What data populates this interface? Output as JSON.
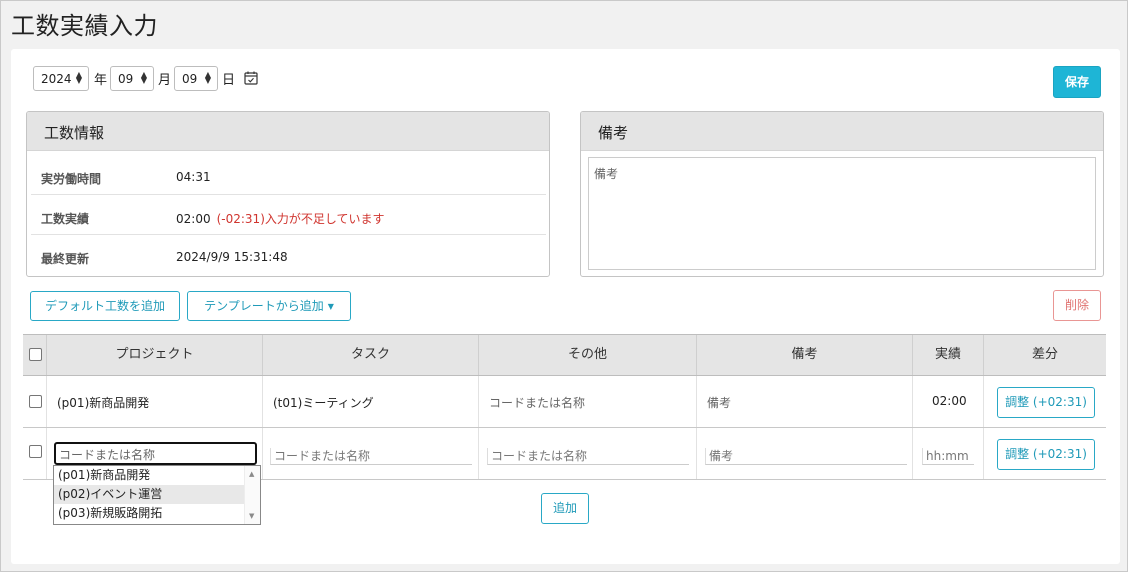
{
  "page": {
    "title": "工数実績入力"
  },
  "date": {
    "year": "2024",
    "year_label": "年",
    "month": "09",
    "month_label": "月",
    "day": "09",
    "day_label": "日",
    "calendar_icon": "calendar-icon"
  },
  "toolbar": {
    "save_label": "保存",
    "delete_label": "削除"
  },
  "work_info": {
    "title": "工数情報",
    "rows": [
      {
        "key": "実労働時間",
        "value": "04:31",
        "warning": ""
      },
      {
        "key": "工数実績",
        "value": "02:00",
        "warning": "(-02:31)入力が不足しています"
      },
      {
        "key": "最終更新",
        "value": "2024/9/9 15:31:48",
        "warning": ""
      }
    ]
  },
  "notes": {
    "title": "備考",
    "placeholder": "備考"
  },
  "actions": {
    "add_default_label": "デフォルト工数を追加",
    "add_template_label": "テンプレートから追加"
  },
  "table": {
    "headers": [
      "プロジェクト",
      "タスク",
      "その他",
      "備考",
      "実績",
      "差分"
    ],
    "rows": [
      {
        "project": "(p01)新商品開発",
        "task": "(t01)ミーティング",
        "other_placeholder": "コードまたは名称",
        "note_placeholder": "備考",
        "actual": "02:00",
        "adjust_label": "調整 (+02:31)"
      }
    ],
    "new_row": {
      "project_placeholder": "コードまたは名称",
      "task_placeholder": "コードまたは名称",
      "other_placeholder": "コードまたは名称",
      "note_placeholder": "備考",
      "actual_placeholder": "hh:mm",
      "adjust_label": "調整 (+02:31)"
    },
    "add_label": "追加"
  },
  "project_dropdown": {
    "options": [
      "(p01)新商品開発",
      "(p02)イベント運営",
      "(p03)新規販路開拓"
    ],
    "highlighted_index": 1
  },
  "colors": {
    "accent": "#1eb5d6",
    "warning": "#d0352f",
    "danger": "#e07270"
  }
}
